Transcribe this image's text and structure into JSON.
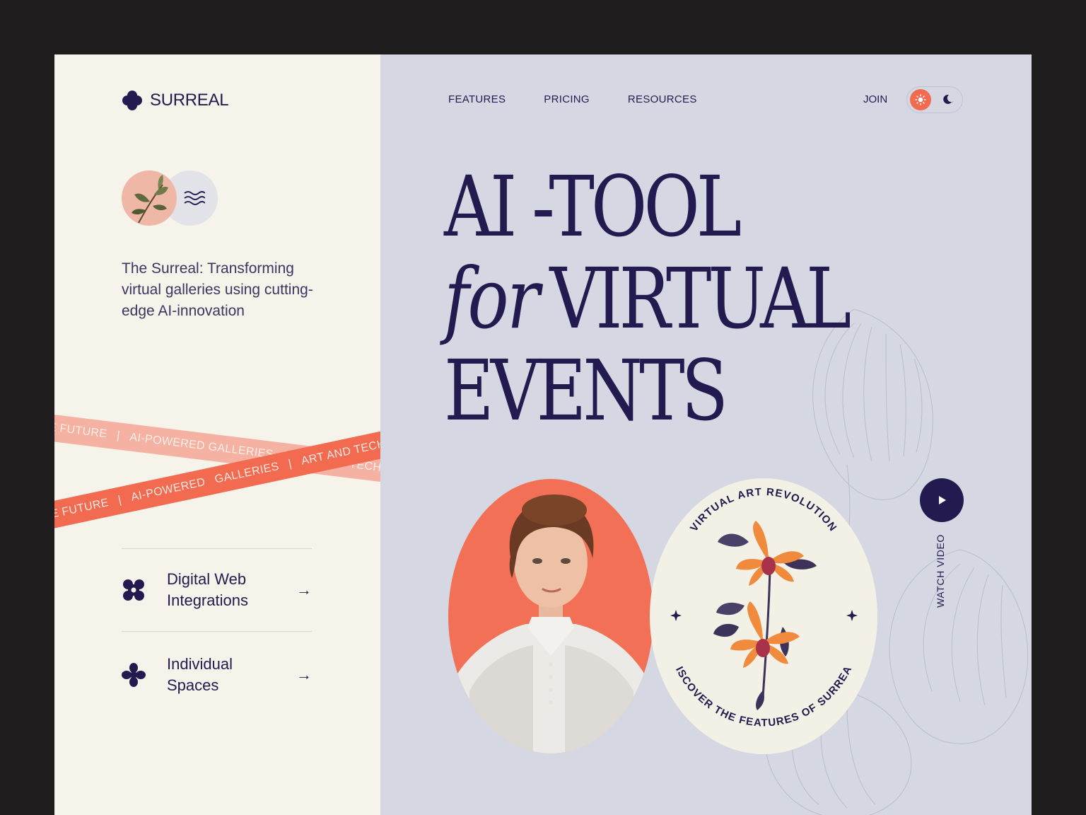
{
  "brand": {
    "name": "SURREAL"
  },
  "intro": "The Surreal: Transforming virtual galleries using cutting-edge AI-innovation",
  "ribbons": {
    "back": [
      "OF THE FUTURE",
      "|",
      "AI-POWERED GALLERIES",
      "|",
      "ART AND TECH"
    ],
    "front": [
      "OF THE FUTURE",
      "|",
      "AI-POWERED",
      "GALLERIES",
      "|",
      "ART AND TECH"
    ]
  },
  "features": [
    {
      "label_line1": "Digital Web",
      "label_line2": "Integrations",
      "icon": "flower-cross-icon",
      "arrow": "→"
    },
    {
      "label_line1": "Individual",
      "label_line2": "Spaces",
      "icon": "clover-icon",
      "arrow": "→"
    }
  ],
  "nav": {
    "items": [
      "FEATURES",
      "PRICING",
      "RESOURCES"
    ],
    "join": "JOIN"
  },
  "theme_toggle": {
    "light_icon": "sun-icon",
    "dark_icon": "moon-icon",
    "active": "light"
  },
  "headline": {
    "line1": "AI -TOOL",
    "line2_italic": "for",
    "line2": "VIRTUAL",
    "line3": "EVENTS"
  },
  "badge": {
    "top_text": "VIRTUAL ART REVOLUTION",
    "bottom_text": "DISCOVER THE FEATURES OF SURREAL"
  },
  "video": {
    "label": "WATCH VIDEO",
    "icon": "play-icon"
  },
  "colors": {
    "ink": "#231a4f",
    "accent": "#f26a50",
    "left_bg": "#f5f3ea",
    "right_bg": "#d5d8e3"
  }
}
